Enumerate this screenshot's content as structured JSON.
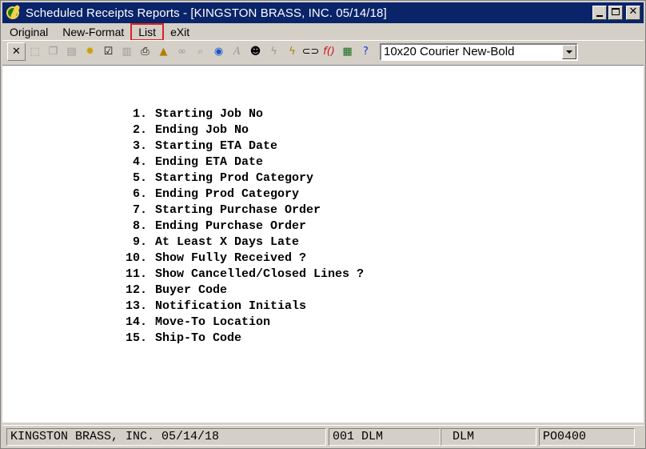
{
  "window": {
    "title": "Scheduled Receipts Reports - [KINGSTON BRASS, INC. 05/14/18]"
  },
  "menubar": {
    "items": [
      {
        "label": "Original"
      },
      {
        "label": "New-Format"
      },
      {
        "label": "List"
      },
      {
        "label": "eXit"
      }
    ]
  },
  "toolbar": {
    "icons": [
      "close-icon",
      "select-icon",
      "copy-icon",
      "paste-icon",
      "settings-gear-icon",
      "properties-icon",
      "notepad-icon",
      "print-icon",
      "alert-bell-icon",
      "binoculars-icon",
      "magnifier-icon",
      "globe-icon",
      "font-icon",
      "user-icon",
      "lightning-icon",
      "edit-lightning-icon",
      "link-icon",
      "function-icon",
      "calculator-icon",
      "help-pointer-icon"
    ],
    "font_value": "10x20 Courier New-Bold"
  },
  "options": [
    {
      "num": "1.",
      "label": "Starting Job No"
    },
    {
      "num": "2.",
      "label": "Ending Job No"
    },
    {
      "num": "3.",
      "label": "Starting ETA Date"
    },
    {
      "num": "4.",
      "label": "Ending ETA Date"
    },
    {
      "num": "5.",
      "label": "Starting Prod Category"
    },
    {
      "num": "6.",
      "label": "Ending Prod Category"
    },
    {
      "num": "7.",
      "label": "Starting Purchase Order"
    },
    {
      "num": "8.",
      "label": "Ending Purchase Order"
    },
    {
      "num": "9.",
      "label": "At Least X Days Late"
    },
    {
      "num": "10.",
      "label": "Show Fully Received ?"
    },
    {
      "num": "11.",
      "label": "Show Cancelled/Closed Lines ?"
    },
    {
      "num": "12.",
      "label": "Buyer Code"
    },
    {
      "num": "13.",
      "label": "Notification Initials"
    },
    {
      "num": "14.",
      "label": "Move-To Location"
    },
    {
      "num": "15.",
      "label": "Ship-To Code"
    }
  ],
  "status": {
    "company": "KINGSTON BRASS, INC. 05/14/18",
    "user": "001 DLM",
    "initials": "DLM",
    "program": "PO0400"
  }
}
